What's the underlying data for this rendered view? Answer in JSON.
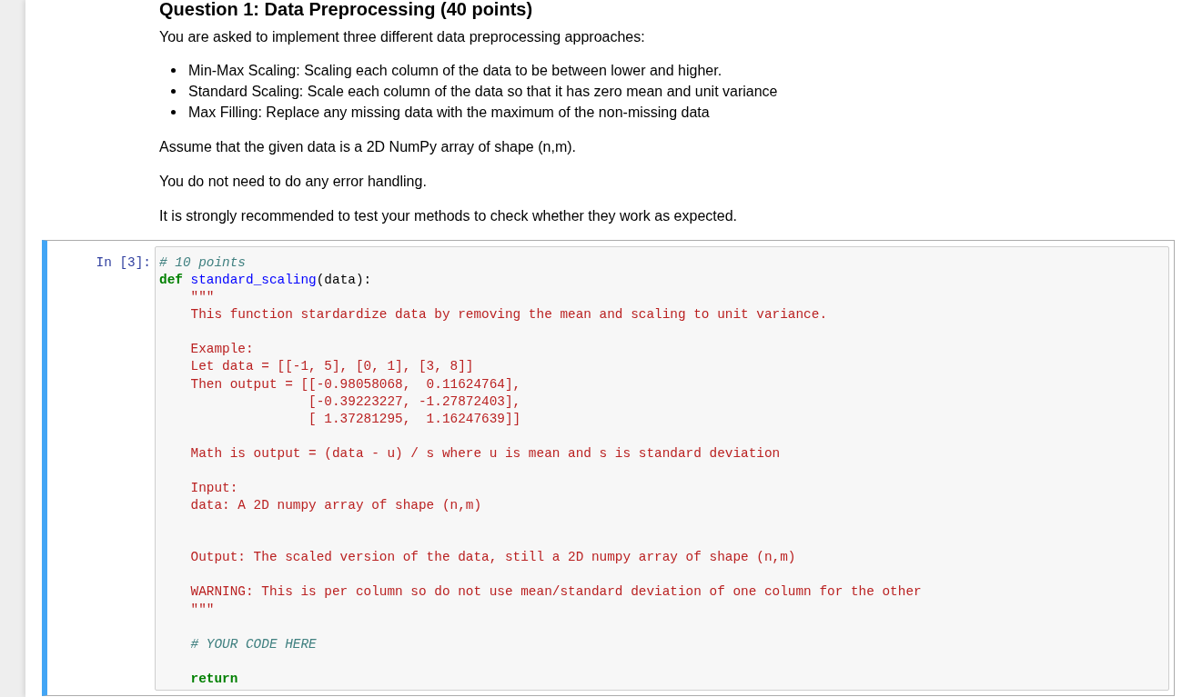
{
  "markdown": {
    "heading": "Question 1: Data Preprocessing (40 points)",
    "intro": "You are asked to implement three different data preprocessing approaches:",
    "bullets": [
      "Min-Max Scaling: Scaling each column of the data to be between lower and higher.",
      "Standard Scaling: Scale each column of the data so that it has zero mean and unit variance",
      "Max Filling: Replace any missing data with the maximum of the non-missing data"
    ],
    "paragraphs": [
      "Assume that the given data is a 2D NumPy array of shape (n,m).",
      "You do not need to do any error handling.",
      "It is strongly recommended to test your methods to check whether they work as expected."
    ]
  },
  "code_cell": {
    "selected": true,
    "prompt": "In [3]:",
    "lines": [
      {
        "kind": "code",
        "tokens": [
          {
            "kind": "comment",
            "text": "# 10 points"
          }
        ]
      },
      {
        "kind": "code",
        "tokens": [
          {
            "kind": "keyword",
            "text": "def"
          },
          {
            "kind": "function",
            "text": " standard_scaling"
          },
          {
            "kind": "plain",
            "text": "(data):"
          }
        ]
      },
      {
        "kind": "code",
        "tokens": [
          {
            "kind": "string",
            "text": "    \"\"\""
          }
        ]
      },
      {
        "kind": "code",
        "tokens": [
          {
            "kind": "string",
            "text": "    This function stardardize data by removing the mean and scaling to unit variance."
          }
        ]
      },
      {
        "kind": "blank"
      },
      {
        "kind": "code",
        "tokens": [
          {
            "kind": "string",
            "text": "    Example:"
          }
        ]
      },
      {
        "kind": "code",
        "tokens": [
          {
            "kind": "string",
            "text": "    Let data = [[-1, 5], [0, 1], [3, 8]]"
          }
        ]
      },
      {
        "kind": "code",
        "tokens": [
          {
            "kind": "string",
            "text": "    Then output = [[-0.98058068,  0.11624764],"
          }
        ]
      },
      {
        "kind": "code",
        "tokens": [
          {
            "kind": "string",
            "text": "                   [-0.39223227, -1.27872403],"
          }
        ]
      },
      {
        "kind": "code",
        "tokens": [
          {
            "kind": "string",
            "text": "                   [ 1.37281295,  1.16247639]]"
          }
        ]
      },
      {
        "kind": "blank"
      },
      {
        "kind": "code",
        "tokens": [
          {
            "kind": "string",
            "text": "    Math is output = (data - u) / s where u is mean and s is standard deviation"
          }
        ]
      },
      {
        "kind": "blank"
      },
      {
        "kind": "code",
        "tokens": [
          {
            "kind": "string",
            "text": "    Input:"
          }
        ]
      },
      {
        "kind": "code",
        "tokens": [
          {
            "kind": "string",
            "text": "    data: A 2D numpy array of shape (n,m)"
          }
        ]
      },
      {
        "kind": "blank"
      },
      {
        "kind": "blank"
      },
      {
        "kind": "code",
        "tokens": [
          {
            "kind": "string",
            "text": "    Output: The scaled version of the data, still a 2D numpy array of shape (n,m)"
          }
        ]
      },
      {
        "kind": "blank"
      },
      {
        "kind": "code",
        "tokens": [
          {
            "kind": "string",
            "text": "    WARNING: This is per column so do not use mean/standard deviation of one column for the other"
          }
        ]
      },
      {
        "kind": "code",
        "tokens": [
          {
            "kind": "string",
            "text": "    \"\"\""
          }
        ]
      },
      {
        "kind": "blank"
      },
      {
        "kind": "code",
        "tokens": [
          {
            "kind": "comment",
            "text": "    # YOUR CODE HERE"
          }
        ]
      },
      {
        "kind": "blank"
      },
      {
        "kind": "code",
        "tokens": [
          {
            "kind": "keyword",
            "text": "    return"
          }
        ]
      }
    ]
  }
}
